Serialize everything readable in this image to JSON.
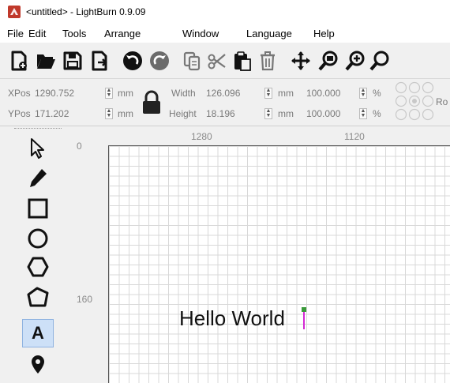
{
  "window": {
    "title": "<untitled> - LightBurn 0.9.09"
  },
  "menu": {
    "items": [
      "File",
      "Edit",
      "Tools",
      "Arrange",
      "Window",
      "Language",
      "Help"
    ]
  },
  "toolbar": {
    "icons": [
      "new-file-icon",
      "open-folder-icon",
      "save-icon",
      "import-icon",
      "undo-icon",
      "redo-icon",
      "copy-icon",
      "cut-icon",
      "paste-icon",
      "delete-icon",
      "move-icon",
      "zoom-icon",
      "zoom-in-icon",
      "zoom-out-icon"
    ]
  },
  "numeric_panel": {
    "xpos_label": "XPos",
    "xpos_value": "1290.752",
    "ypos_label": "YPos",
    "ypos_value": "171.202",
    "unit_mm": "mm",
    "width_label": "Width",
    "width_value": "126.096",
    "height_label": "Height",
    "height_value": "18.196",
    "scale_x": "100.000",
    "scale_y": "100.000",
    "percent": "%",
    "rotate_label": "Ro"
  },
  "left_tools": {
    "icons": [
      "select-arrow-icon",
      "edit-nodes-pen-icon",
      "rectangle-icon",
      "ellipse-icon",
      "polygon-icon",
      "position-laser-icon",
      "text-tool-icon",
      "marker-icon"
    ],
    "text_tool_label": "A"
  },
  "rulers": {
    "top_labels": [
      "0",
      "1280",
      "1120"
    ],
    "left_label": "160"
  },
  "canvas": {
    "text_object": "Hello World"
  },
  "colors": {
    "accent": "#cde0f7",
    "grid_line": "#d8d8d8",
    "cursor_green": "#3a9a3a",
    "cursor_magenta": "#d42ad4"
  }
}
